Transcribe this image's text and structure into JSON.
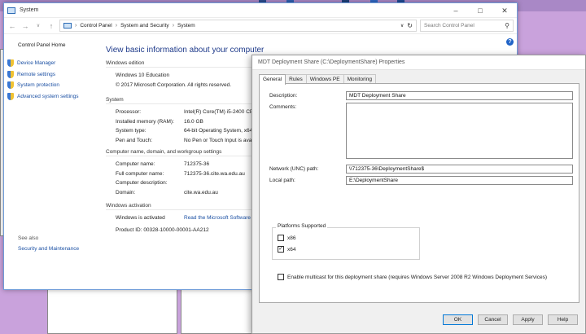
{
  "system_window": {
    "title": "System",
    "breadcrumb": [
      "Control Panel",
      "System and Security",
      "System"
    ],
    "search_placeholder": "Search Control Panel",
    "sidebar": {
      "home": "Control Panel Home",
      "items": [
        "Device Manager",
        "Remote settings",
        "System protection",
        "Advanced system settings"
      ],
      "see_also": "See also",
      "security_maintenance": "Security and Maintenance"
    },
    "heading": "View basic information about your computer",
    "edition": {
      "header": "Windows edition",
      "name": "Windows 10 Education",
      "copyright": "© 2017 Microsoft Corporation. All rights reserved."
    },
    "system": {
      "header": "System",
      "rows": [
        {
          "label": "Processor:",
          "value": "Intel(R) Core(TM) i5-2400 CPU"
        },
        {
          "label": "Installed memory (RAM):",
          "value": "16.0 GB"
        },
        {
          "label": "System type:",
          "value": "64-bit Operating System, x64-"
        },
        {
          "label": "Pen and Touch:",
          "value": "No Pen or Touch Input is avail"
        }
      ]
    },
    "computer_name": {
      "header": "Computer name, domain, and workgroup settings",
      "rows": [
        {
          "label": "Computer name:",
          "value": "712375-36"
        },
        {
          "label": "Full computer name:",
          "value": "712375-36.cite.wa.edu.au"
        },
        {
          "label": "Computer description:",
          "value": ""
        },
        {
          "label": "Domain:",
          "value": "cite.wa.edu.au"
        }
      ]
    },
    "activation": {
      "header": "Windows activation",
      "status": "Windows is activated",
      "link": "Read the Microsoft Software Licens",
      "product_id": "Product ID: 00328-10000-00001-AA212"
    }
  },
  "dialog": {
    "title": "MDT Deployment Share (C:\\DeploymentShare) Properties",
    "tabs": [
      "General",
      "Rules",
      "Windows PE",
      "Monitoring"
    ],
    "description_label": "Description:",
    "description_value": "MDT Deployment Share",
    "comments_label": "Comments:",
    "comments_value": "",
    "unc_label": "Network (UNC) path:",
    "unc_value": "\\\\712375-36\\DeploymentShare$",
    "local_label": "Local path:",
    "local_value": "E:\\DeploymentShare",
    "platforms_title": "Platforms Supported",
    "x86_label": "x86",
    "x86_checked": false,
    "x64_label": "x64",
    "x64_checked": true,
    "multicast_label": "Enable multicast for this deployment share (requires Windows Server 2008 R2 Windows Deployment Services)",
    "multicast_checked": false,
    "buttons": {
      "ok": "OK",
      "cancel": "Cancel",
      "apply": "Apply",
      "help": "Help"
    }
  }
}
